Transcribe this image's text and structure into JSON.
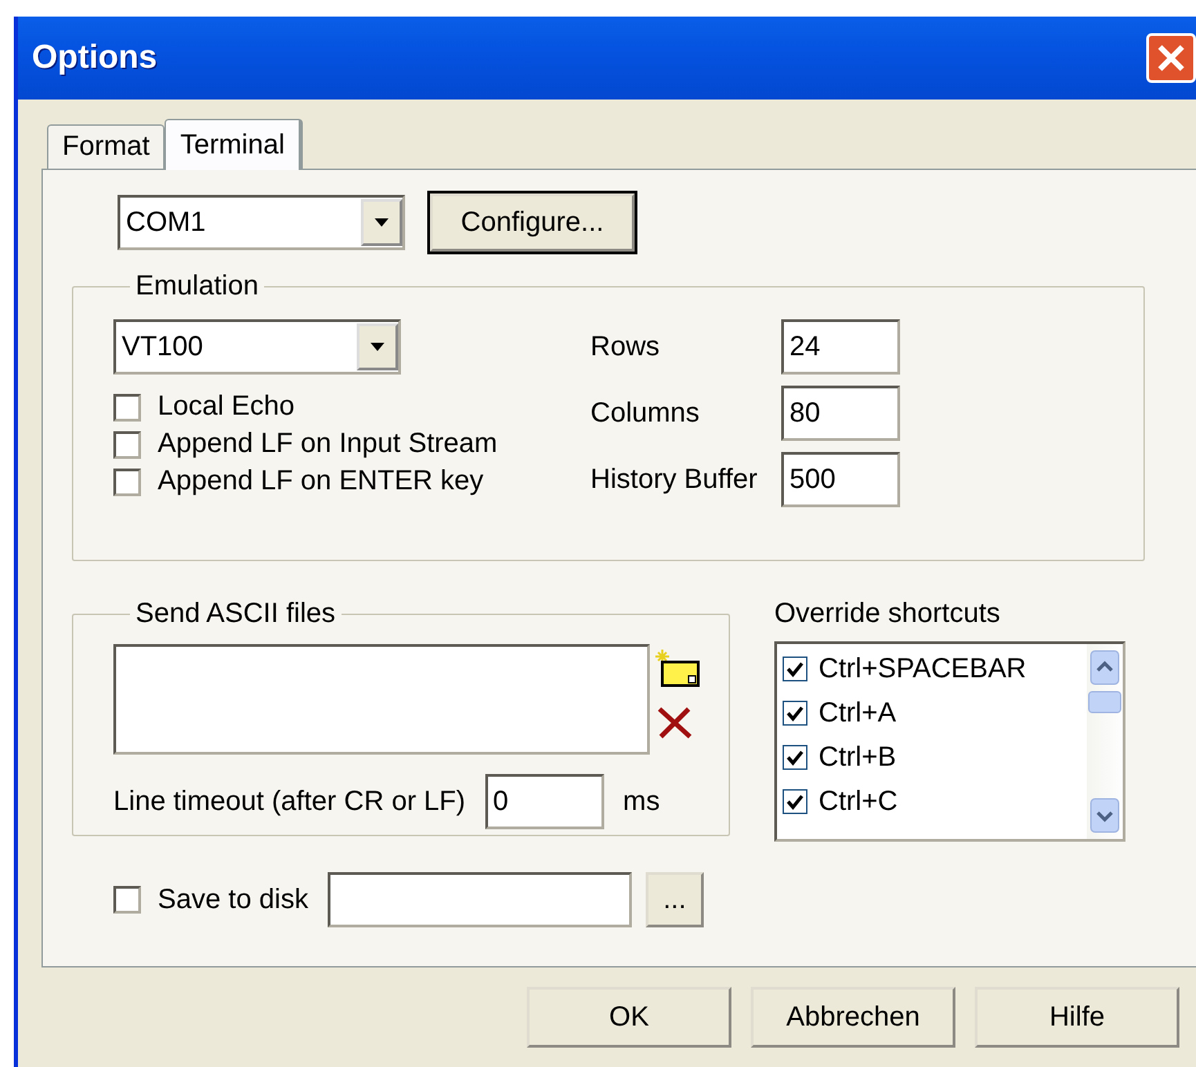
{
  "window": {
    "title": "Options"
  },
  "tabs": [
    {
      "label": "Format",
      "selected": false
    },
    {
      "label": "Terminal",
      "selected": true
    }
  ],
  "port": {
    "value": "COM1"
  },
  "configure_button": "Configure...",
  "emulation": {
    "title": "Emulation",
    "type": {
      "value": "VT100"
    },
    "options": [
      {
        "label": "Local Echo",
        "checked": false
      },
      {
        "label": "Append LF on Input Stream",
        "checked": false
      },
      {
        "label": "Append LF on ENTER key",
        "checked": false
      }
    ],
    "fields": [
      {
        "label": "Rows",
        "value": "24"
      },
      {
        "label": "Columns",
        "value": "80"
      },
      {
        "label": "History Buffer",
        "value": "500"
      }
    ]
  },
  "send_ascii": {
    "title": "Send ASCII files",
    "timeout_label": "Line timeout (after CR or LF)",
    "timeout_value": "0",
    "timeout_unit": "ms"
  },
  "override_shortcuts": {
    "title": "Override shortcuts",
    "items": [
      {
        "label": "Ctrl+SPACEBAR",
        "checked": true
      },
      {
        "label": "Ctrl+A",
        "checked": true
      },
      {
        "label": "Ctrl+B",
        "checked": true
      },
      {
        "label": "Ctrl+C",
        "checked": true
      }
    ]
  },
  "save_to_disk": {
    "label": "Save to disk",
    "checked": false,
    "browse": "..."
  },
  "buttons": [
    "OK",
    "Abbrechen",
    "Hilfe"
  ]
}
